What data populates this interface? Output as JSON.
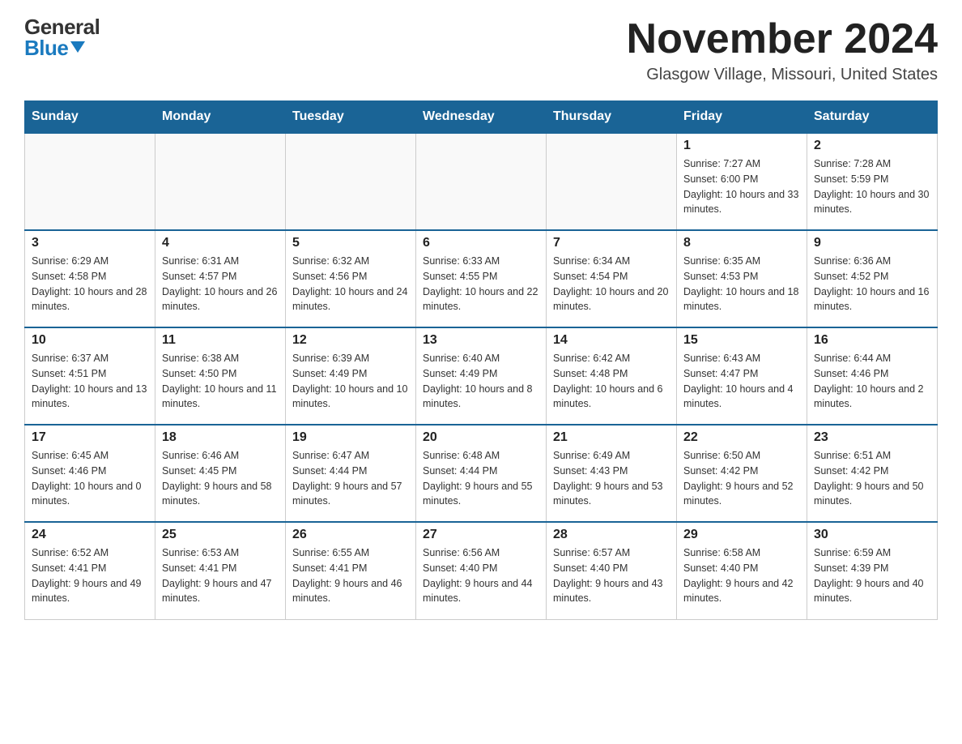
{
  "logo": {
    "general": "General",
    "blue": "Blue"
  },
  "header": {
    "month_year": "November 2024",
    "location": "Glasgow Village, Missouri, United States"
  },
  "days_of_week": [
    "Sunday",
    "Monday",
    "Tuesday",
    "Wednesday",
    "Thursday",
    "Friday",
    "Saturday"
  ],
  "weeks": [
    [
      {
        "day": "",
        "info": ""
      },
      {
        "day": "",
        "info": ""
      },
      {
        "day": "",
        "info": ""
      },
      {
        "day": "",
        "info": ""
      },
      {
        "day": "",
        "info": ""
      },
      {
        "day": "1",
        "info": "Sunrise: 7:27 AM\nSunset: 6:00 PM\nDaylight: 10 hours and 33 minutes."
      },
      {
        "day": "2",
        "info": "Sunrise: 7:28 AM\nSunset: 5:59 PM\nDaylight: 10 hours and 30 minutes."
      }
    ],
    [
      {
        "day": "3",
        "info": "Sunrise: 6:29 AM\nSunset: 4:58 PM\nDaylight: 10 hours and 28 minutes."
      },
      {
        "day": "4",
        "info": "Sunrise: 6:31 AM\nSunset: 4:57 PM\nDaylight: 10 hours and 26 minutes."
      },
      {
        "day": "5",
        "info": "Sunrise: 6:32 AM\nSunset: 4:56 PM\nDaylight: 10 hours and 24 minutes."
      },
      {
        "day": "6",
        "info": "Sunrise: 6:33 AM\nSunset: 4:55 PM\nDaylight: 10 hours and 22 minutes."
      },
      {
        "day": "7",
        "info": "Sunrise: 6:34 AM\nSunset: 4:54 PM\nDaylight: 10 hours and 20 minutes."
      },
      {
        "day": "8",
        "info": "Sunrise: 6:35 AM\nSunset: 4:53 PM\nDaylight: 10 hours and 18 minutes."
      },
      {
        "day": "9",
        "info": "Sunrise: 6:36 AM\nSunset: 4:52 PM\nDaylight: 10 hours and 16 minutes."
      }
    ],
    [
      {
        "day": "10",
        "info": "Sunrise: 6:37 AM\nSunset: 4:51 PM\nDaylight: 10 hours and 13 minutes."
      },
      {
        "day": "11",
        "info": "Sunrise: 6:38 AM\nSunset: 4:50 PM\nDaylight: 10 hours and 11 minutes."
      },
      {
        "day": "12",
        "info": "Sunrise: 6:39 AM\nSunset: 4:49 PM\nDaylight: 10 hours and 10 minutes."
      },
      {
        "day": "13",
        "info": "Sunrise: 6:40 AM\nSunset: 4:49 PM\nDaylight: 10 hours and 8 minutes."
      },
      {
        "day": "14",
        "info": "Sunrise: 6:42 AM\nSunset: 4:48 PM\nDaylight: 10 hours and 6 minutes."
      },
      {
        "day": "15",
        "info": "Sunrise: 6:43 AM\nSunset: 4:47 PM\nDaylight: 10 hours and 4 minutes."
      },
      {
        "day": "16",
        "info": "Sunrise: 6:44 AM\nSunset: 4:46 PM\nDaylight: 10 hours and 2 minutes."
      }
    ],
    [
      {
        "day": "17",
        "info": "Sunrise: 6:45 AM\nSunset: 4:46 PM\nDaylight: 10 hours and 0 minutes."
      },
      {
        "day": "18",
        "info": "Sunrise: 6:46 AM\nSunset: 4:45 PM\nDaylight: 9 hours and 58 minutes."
      },
      {
        "day": "19",
        "info": "Sunrise: 6:47 AM\nSunset: 4:44 PM\nDaylight: 9 hours and 57 minutes."
      },
      {
        "day": "20",
        "info": "Sunrise: 6:48 AM\nSunset: 4:44 PM\nDaylight: 9 hours and 55 minutes."
      },
      {
        "day": "21",
        "info": "Sunrise: 6:49 AM\nSunset: 4:43 PM\nDaylight: 9 hours and 53 minutes."
      },
      {
        "day": "22",
        "info": "Sunrise: 6:50 AM\nSunset: 4:42 PM\nDaylight: 9 hours and 52 minutes."
      },
      {
        "day": "23",
        "info": "Sunrise: 6:51 AM\nSunset: 4:42 PM\nDaylight: 9 hours and 50 minutes."
      }
    ],
    [
      {
        "day": "24",
        "info": "Sunrise: 6:52 AM\nSunset: 4:41 PM\nDaylight: 9 hours and 49 minutes."
      },
      {
        "day": "25",
        "info": "Sunrise: 6:53 AM\nSunset: 4:41 PM\nDaylight: 9 hours and 47 minutes."
      },
      {
        "day": "26",
        "info": "Sunrise: 6:55 AM\nSunset: 4:41 PM\nDaylight: 9 hours and 46 minutes."
      },
      {
        "day": "27",
        "info": "Sunrise: 6:56 AM\nSunset: 4:40 PM\nDaylight: 9 hours and 44 minutes."
      },
      {
        "day": "28",
        "info": "Sunrise: 6:57 AM\nSunset: 4:40 PM\nDaylight: 9 hours and 43 minutes."
      },
      {
        "day": "29",
        "info": "Sunrise: 6:58 AM\nSunset: 4:40 PM\nDaylight: 9 hours and 42 minutes."
      },
      {
        "day": "30",
        "info": "Sunrise: 6:59 AM\nSunset: 4:39 PM\nDaylight: 9 hours and 40 minutes."
      }
    ]
  ]
}
